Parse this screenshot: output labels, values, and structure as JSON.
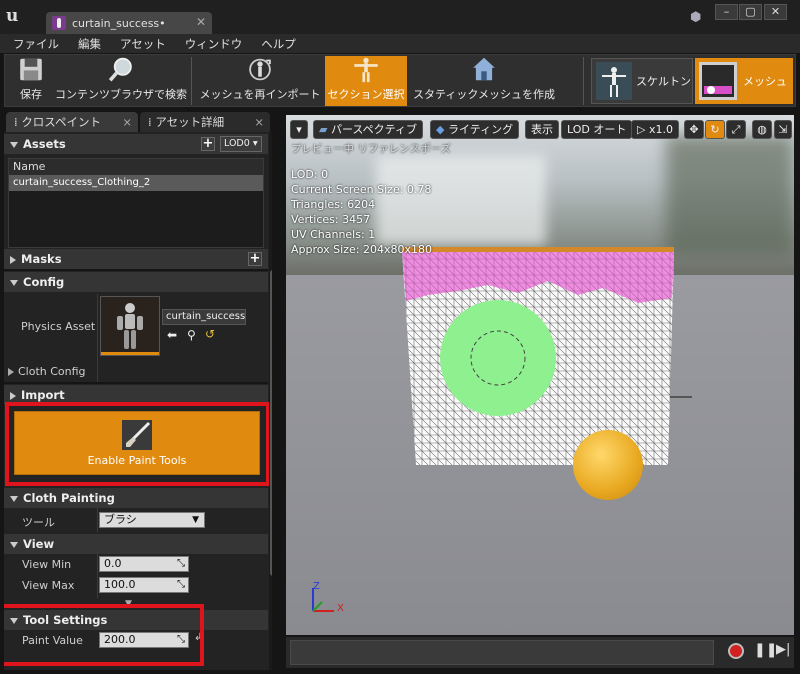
{
  "window": {
    "tab_title": "curtain_success•"
  },
  "menu": [
    "ファイル",
    "編集",
    "アセット",
    "ウィンドウ",
    "ヘルプ"
  ],
  "toolbar": {
    "save": "保存",
    "content_browser": "コンテンツブラウザで検索",
    "reimport": "メッシュを再インポート",
    "section_select": "セクション選択",
    "create_static": "スタティックメッシュを作成",
    "skeleton": "スケルトン",
    "mesh": "メッシュ"
  },
  "left_tabs": [
    "クロスペイント",
    "アセット詳細"
  ],
  "assets": {
    "header": "Assets",
    "lod_button": "LOD0",
    "column_name": "Name",
    "selected_item": "curtain_success_Clothing_2"
  },
  "masks": {
    "header": "Masks"
  },
  "config": {
    "header": "Config",
    "physics_asset_label": "Physics Asset",
    "physics_asset_value": "curtain_success",
    "cloth_config_label": "Cloth Config"
  },
  "import": {
    "header": "Import",
    "enable_paint_button": "Enable Paint Tools"
  },
  "cloth_painting": {
    "header": "Cloth Painting",
    "tool_label": "ツール",
    "tool_value": "ブラシ"
  },
  "view": {
    "header": "View",
    "view_min_label": "View Min",
    "view_min_value": "0.0",
    "view_max_label": "View Max",
    "view_max_value": "100.0"
  },
  "tool_settings": {
    "header": "Tool Settings",
    "paint_value_label": "Paint Value",
    "paint_value": "200.0"
  },
  "viewport": {
    "perspective": "パースペクティブ",
    "lighting": "ライティング",
    "show": "表示",
    "lod_auto": "LOD オート",
    "speed": "x1.0",
    "preview_caption": "プレビュー中 リファレンスポーズ",
    "stats": [
      "LOD: 0",
      "Current Screen Size: 0.78",
      "Triangles: 6204",
      "Vertices: 3457",
      "UV Channels: 1",
      "Approx Size: 204x80x180"
    ],
    "axis_z": "Z",
    "axis_x": "X"
  },
  "colors": {
    "accent_orange": "#e08a10",
    "highlight_red": "#e0141c",
    "paint_green": "#8ff08f",
    "paint_pink": "#f080e0"
  }
}
